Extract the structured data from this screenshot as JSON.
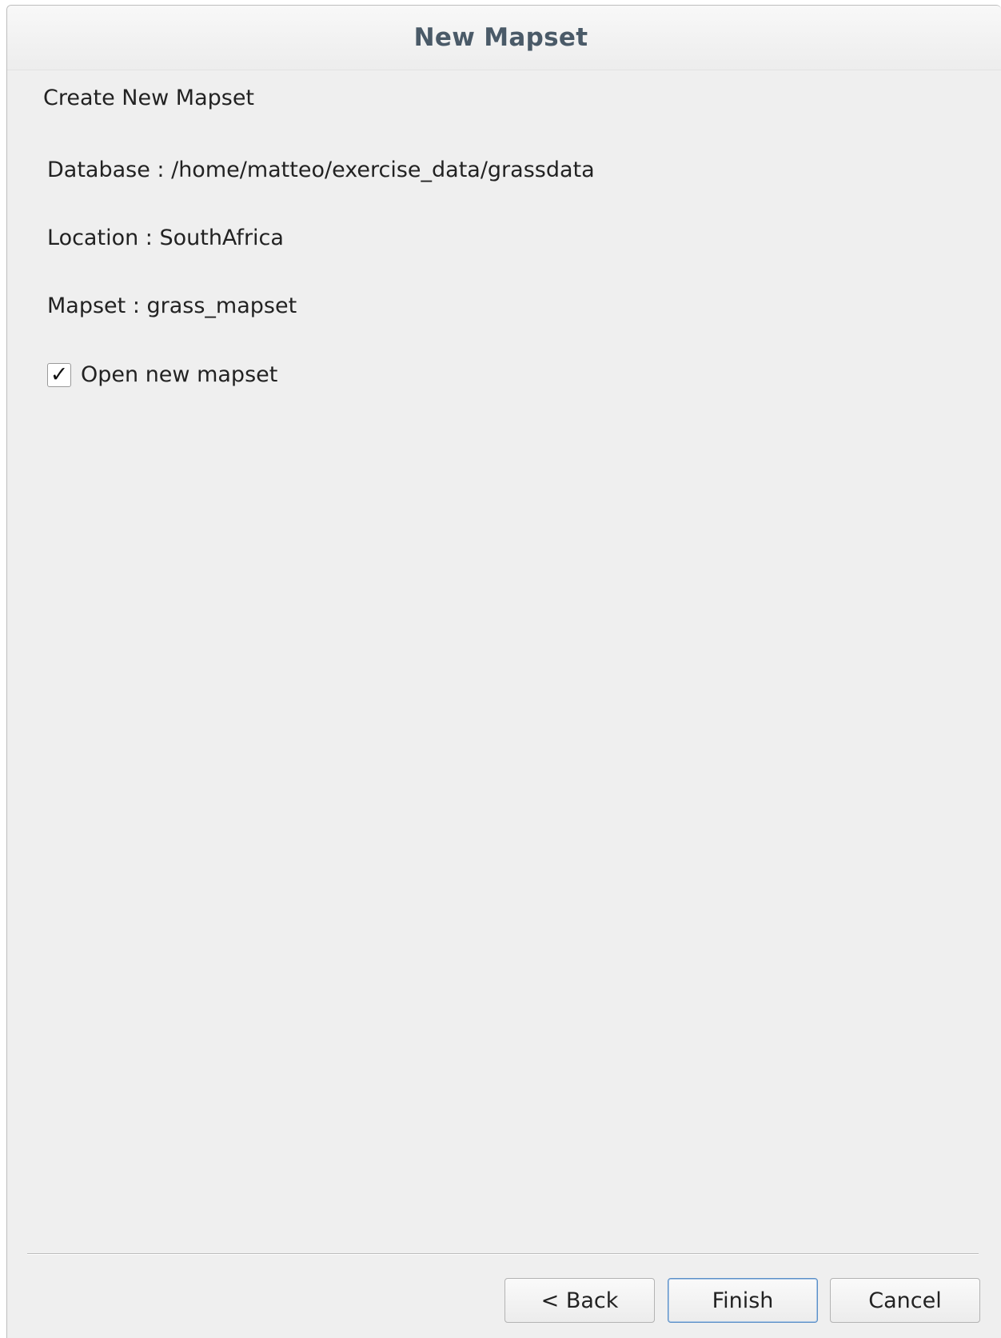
{
  "window": {
    "title": "New Mapset"
  },
  "page": {
    "heading": "Create New Mapset",
    "database_line": "Database : /home/matteo/exercise_data/grassdata",
    "location_line": "Location : SouthAfrica",
    "mapset_line": "Mapset : grass_mapset"
  },
  "options": {
    "open_new_mapset_label": "Open new mapset",
    "open_new_mapset_checked": true,
    "check_glyph": "✓"
  },
  "buttons": {
    "back_label": "< Back",
    "finish_label": "Finish",
    "cancel_label": "Cancel"
  },
  "colors": {
    "title": "#4a5a68",
    "background": "#efefef",
    "default_button_border": "#5b8fc7"
  }
}
